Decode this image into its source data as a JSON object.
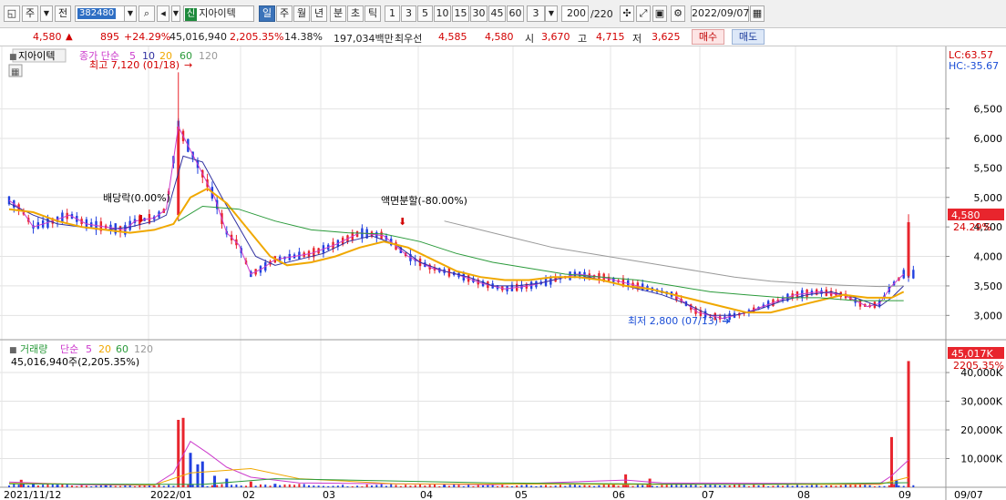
{
  "toolbar": {
    "stock_label": "주",
    "prev_label": "전",
    "code": "382480",
    "stock_tag": "신",
    "stock_name": "지아이텍",
    "periods": [
      "일",
      "주",
      "월",
      "년",
      "분",
      "초",
      "틱"
    ],
    "intervals": [
      "1",
      "3",
      "5",
      "10",
      "15",
      "30",
      "45",
      "60"
    ],
    "interval_select": "3",
    "count": "200",
    "count_total": "/220",
    "date": "2022/09/07"
  },
  "quote": {
    "price": "4,580",
    "arrow": "▲",
    "change": "895",
    "change_pct": "+24.29%",
    "volume": "45,016,940",
    "volume_pct": "2,205.35%",
    "turnover": "14.38%",
    "amount": "197,034백만",
    "best_ask_label": "최우선",
    "best_ask": "4,585",
    "best_bid": "4,580",
    "open_label": "시",
    "open": "3,670",
    "high_label": "고",
    "high": "4,715",
    "low_label": "저",
    "low": "3,625",
    "sell_label": "매수",
    "buy_label": "매도"
  },
  "price_panel": {
    "title": "지아이텍",
    "ma_label": "종가 단순",
    "ma_periods": [
      "5",
      "10",
      "20",
      "60",
      "120"
    ],
    "lc": "LC:63.57",
    "hc": "HC:-35.67",
    "last_price": "4,580",
    "last_pct": "24.29%",
    "high_ann": "최고 7,120 (01/18)",
    "low_ann": "최저 2,800 (07/13)",
    "dividend_ann": "배당락(0.00%)",
    "split_ann": "액면분할(-80.00%)"
  },
  "volume_panel": {
    "title": "거래량",
    "ma_label": "단순",
    "ma_periods": [
      "5",
      "20",
      "60",
      "120"
    ],
    "summary": "45,016,940주(2,205.35%)",
    "last_value": "45,017K",
    "last_pct": "2205.35%"
  },
  "colors": {
    "up": "#e8252d",
    "down": "#2140e0",
    "ma5": "#cc3acc",
    "ma10": "#3030a0",
    "ma20": "#f0a800",
    "ma60": "#2a9a3a",
    "ma120": "#999999"
  },
  "chart_data": [
    {
      "type": "candlestick",
      "title": "지아이텍",
      "y_ticks": [
        3000,
        3500,
        4000,
        4500,
        5000,
        5500,
        6000,
        6500
      ],
      "ylim": [
        2650,
        7250
      ],
      "x_ticks": [
        "2021/11/12",
        "2022/01",
        "02",
        "03",
        "04",
        "05",
        "06",
        "07",
        "08",
        "09",
        "09/07"
      ],
      "ma_series": [
        {
          "name": "5",
          "points": [
            [
              0,
              4950
            ],
            [
              5,
              4800
            ],
            [
              10,
              4500
            ],
            [
              18,
              4600
            ],
            [
              25,
              4700
            ],
            [
              32,
              4550
            ],
            [
              40,
              4500
            ],
            [
              48,
              4450
            ],
            [
              52,
              4600
            ],
            [
              60,
              4650
            ],
            [
              65,
              4800
            ],
            [
              70,
              6200
            ],
            [
              75,
              5800
            ],
            [
              80,
              5400
            ],
            [
              85,
              5000
            ],
            [
              90,
              4400
            ],
            [
              95,
              4200
            ],
            [
              100,
              3700
            ],
            [
              105,
              3800
            ],
            [
              110,
              3950
            ],
            [
              118,
              4000
            ],
            [
              125,
              4050
            ],
            [
              135,
              4200
            ],
            [
              145,
              4400
            ],
            [
              155,
              4350
            ],
            [
              165,
              4000
            ],
            [
              175,
              3800
            ],
            [
              185,
              3700
            ],
            [
              195,
              3550
            ],
            [
              205,
              3450
            ],
            [
              215,
              3500
            ],
            [
              225,
              3600
            ],
            [
              235,
              3700
            ],
            [
              245,
              3650
            ],
            [
              255,
              3550
            ],
            [
              265,
              3450
            ],
            [
              275,
              3350
            ],
            [
              285,
              3050
            ],
            [
              295,
              2950
            ],
            [
              305,
              3050
            ],
            [
              315,
              3200
            ],
            [
              325,
              3350
            ],
            [
              335,
              3400
            ],
            [
              345,
              3350
            ],
            [
              355,
              3150
            ],
            [
              360,
              3200
            ],
            [
              365,
              3500
            ],
            [
              370,
              3700
            ]
          ]
        },
        {
          "name": "10",
          "points": [
            [
              0,
              4900
            ],
            [
              10,
              4700
            ],
            [
              20,
              4550
            ],
            [
              30,
              4500
            ],
            [
              40,
              4450
            ],
            [
              50,
              4500
            ],
            [
              60,
              4600
            ],
            [
              65,
              4700
            ],
            [
              72,
              5700
            ],
            [
              80,
              5600
            ],
            [
              88,
              5000
            ],
            [
              95,
              4500
            ],
            [
              102,
              4000
            ],
            [
              110,
              3850
            ],
            [
              120,
              3950
            ],
            [
              130,
              4050
            ],
            [
              140,
              4250
            ],
            [
              150,
              4350
            ],
            [
              160,
              4200
            ],
            [
              170,
              3900
            ],
            [
              180,
              3750
            ],
            [
              190,
              3650
            ],
            [
              200,
              3500
            ],
            [
              210,
              3500
            ],
            [
              220,
              3550
            ],
            [
              230,
              3650
            ],
            [
              240,
              3650
            ],
            [
              250,
              3550
            ],
            [
              260,
              3450
            ],
            [
              270,
              3350
            ],
            [
              280,
              3200
            ],
            [
              290,
              3000
            ],
            [
              300,
              3000
            ],
            [
              310,
              3100
            ],
            [
              320,
              3250
            ],
            [
              330,
              3350
            ],
            [
              340,
              3400
            ],
            [
              350,
              3300
            ],
            [
              360,
              3150
            ],
            [
              365,
              3300
            ],
            [
              370,
              3500
            ]
          ]
        },
        {
          "name": "20",
          "points": [
            [
              0,
              4800
            ],
            [
              10,
              4750
            ],
            [
              20,
              4600
            ],
            [
              30,
              4500
            ],
            [
              40,
              4450
            ],
            [
              50,
              4400
            ],
            [
              60,
              4450
            ],
            [
              68,
              4550
            ],
            [
              75,
              5000
            ],
            [
              82,
              5150
            ],
            [
              90,
              4900
            ],
            [
              100,
              4400
            ],
            [
              108,
              4000
            ],
            [
              115,
              3850
            ],
            [
              125,
              3900
            ],
            [
              135,
              4000
            ],
            [
              145,
              4150
            ],
            [
              155,
              4250
            ],
            [
              165,
              4150
            ],
            [
              175,
              3950
            ],
            [
              185,
              3750
            ],
            [
              195,
              3650
            ],
            [
              205,
              3600
            ],
            [
              215,
              3600
            ],
            [
              225,
              3650
            ],
            [
              235,
              3650
            ],
            [
              245,
              3600
            ],
            [
              255,
              3500
            ],
            [
              265,
              3450
            ],
            [
              275,
              3350
            ],
            [
              285,
              3250
            ],
            [
              295,
              3150
            ],
            [
              305,
              3050
            ],
            [
              315,
              3050
            ],
            [
              325,
              3150
            ],
            [
              335,
              3250
            ],
            [
              345,
              3350
            ],
            [
              355,
              3300
            ],
            [
              365,
              3300
            ],
            [
              370,
              3400
            ]
          ]
        },
        {
          "name": "60",
          "points": [
            [
              70,
              4600
            ],
            [
              80,
              4850
            ],
            [
              95,
              4800
            ],
            [
              110,
              4600
            ],
            [
              125,
              4450
            ],
            [
              140,
              4400
            ],
            [
              155,
              4380
            ],
            [
              170,
              4250
            ],
            [
              185,
              4050
            ],
            [
              200,
              3900
            ],
            [
              215,
              3800
            ],
            [
              230,
              3700
            ],
            [
              245,
              3650
            ],
            [
              260,
              3600
            ],
            [
              275,
              3500
            ],
            [
              290,
              3400
            ],
            [
              305,
              3350
            ],
            [
              320,
              3300
            ],
            [
              335,
              3300
            ],
            [
              350,
              3250
            ],
            [
              360,
              3250
            ],
            [
              370,
              3250
            ]
          ]
        },
        {
          "name": "120",
          "points": [
            [
              180,
              4600
            ],
            [
              195,
              4450
            ],
            [
              210,
              4300
            ],
            [
              225,
              4150
            ],
            [
              240,
              4050
            ],
            [
              255,
              3950
            ],
            [
              270,
              3850
            ],
            [
              285,
              3750
            ],
            [
              300,
              3650
            ],
            [
              315,
              3580
            ],
            [
              330,
              3540
            ],
            [
              345,
              3510
            ],
            [
              360,
              3490
            ],
            [
              370,
              3500
            ]
          ]
        }
      ]
    },
    {
      "type": "bar",
      "title": "거래량",
      "y_ticks": [
        10000,
        20000,
        30000,
        40000
      ],
      "y_tick_labels": [
        "10,000K",
        "20,000K",
        "30,000K",
        "40,000K"
      ],
      "ylim": [
        0,
        47000
      ],
      "bars": [
        [
          5,
          2600,
          "up"
        ],
        [
          10,
          1500,
          "down"
        ],
        [
          20,
          900,
          "down"
        ],
        [
          40,
          700,
          "down"
        ],
        [
          60,
          500,
          "up"
        ],
        [
          70,
          23500,
          "up"
        ],
        [
          72,
          24200,
          "up"
        ],
        [
          75,
          12000,
          "down"
        ],
        [
          78,
          8000,
          "down"
        ],
        [
          80,
          9000,
          "down"
        ],
        [
          85,
          4000,
          "down"
        ],
        [
          90,
          3000,
          "down"
        ],
        [
          100,
          2000,
          "up"
        ],
        [
          110,
          1200,
          "down"
        ],
        [
          180,
          800,
          "down"
        ],
        [
          250,
          900,
          "up"
        ],
        [
          255,
          4500,
          "up"
        ],
        [
          265,
          3000,
          "up"
        ],
        [
          365,
          17500,
          "up"
        ],
        [
          367,
          2600,
          "down"
        ],
        [
          372,
          44000,
          "up"
        ]
      ]
    }
  ]
}
